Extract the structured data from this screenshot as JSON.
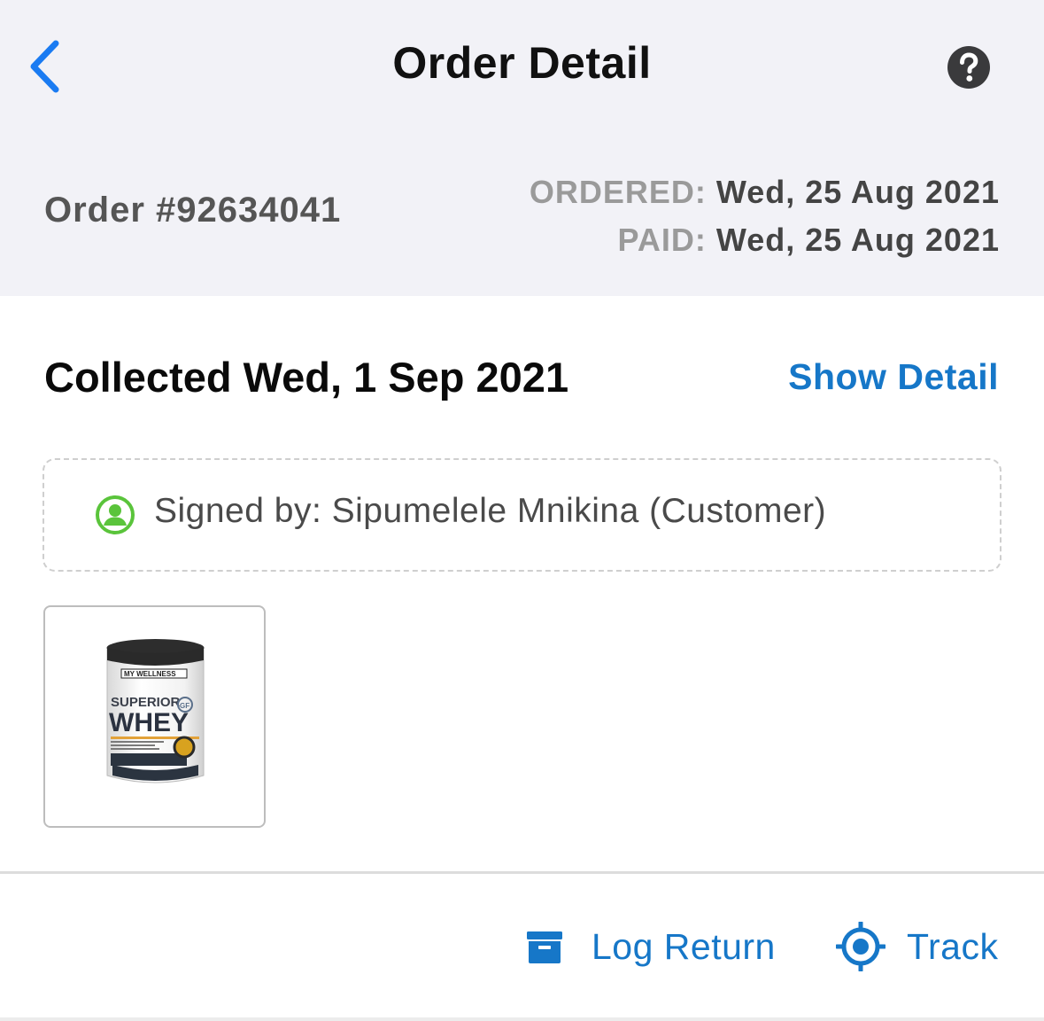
{
  "nav": {
    "title": "Order Detail",
    "back_icon": "chevron-left-icon",
    "help_icon": "question-circle-icon"
  },
  "order": {
    "number": "Order #92634041",
    "ordered_label": "ORDERED:",
    "ordered_date": "Wed, 25 Aug 2021",
    "paid_label": "PAID:",
    "paid_date": "Wed, 25 Aug 2021"
  },
  "status": {
    "title": "Collected Wed, 1 Sep 2021",
    "show_detail_label": "Show Detail",
    "signed_by": "Signed by: Sipumelele Mnikina (Customer)",
    "signed_icon": "person-circle-icon"
  },
  "product": {
    "image": "product-tub-icon",
    "brand_text": "MY WELLNESS",
    "name_line1": "SUPERIOR",
    "name_line2": "WHEY",
    "badge": "GF"
  },
  "actions": {
    "log_return_label": "Log Return",
    "log_return_icon": "archive-box-icon",
    "track_label": "Track",
    "track_icon": "crosshair-icon"
  },
  "colors": {
    "accent": "#1677c8",
    "back_blue": "#1a7bf2",
    "signed_green": "#5ac43b",
    "header_bg": "#f2f2f7"
  }
}
